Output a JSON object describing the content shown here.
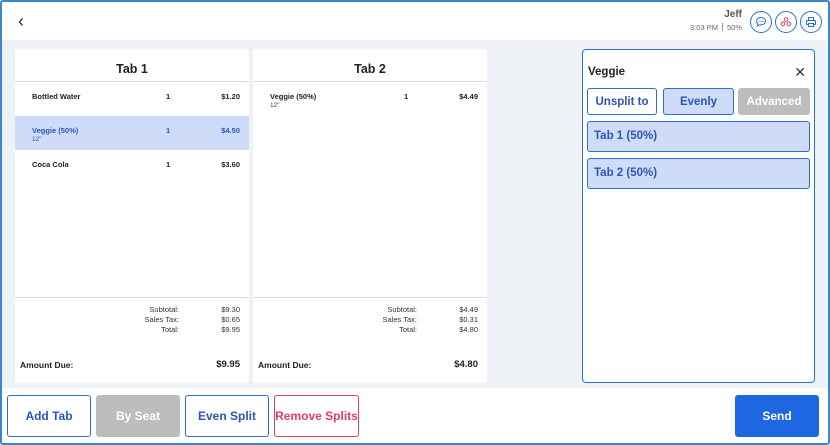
{
  "header": {
    "back_icon": "chevron-left-icon",
    "user_name": "Jeff",
    "time": "3:03 PM",
    "battery": "50%",
    "icons": [
      "chat-icon",
      "group-icon",
      "printer-icon"
    ]
  },
  "tabs": [
    {
      "title": "Tab 1",
      "items": [
        {
          "name": "Bottled Water",
          "sub": "",
          "qty": "1",
          "price": "$1.20",
          "selected": false
        },
        {
          "name": "Veggie (50%)",
          "sub": "12\"",
          "qty": "1",
          "price": "$4.50",
          "selected": true
        },
        {
          "name": "Coca Cola",
          "sub": "",
          "qty": "1",
          "price": "$3.60",
          "selected": false
        }
      ],
      "subtotal_label": "Subtotal:",
      "subtotal": "$9.30",
      "tax_label": "Sales Tax:",
      "tax": "$0.65",
      "total_label": "Total:",
      "total": "$9.95",
      "due_label": "Amount Due:",
      "due": "$9.95"
    },
    {
      "title": "Tab 2",
      "items": [
        {
          "name": "Veggie (50%)",
          "sub": "12\"",
          "qty": "1",
          "price": "$4.49",
          "selected": false
        }
      ],
      "subtotal_label": "Subtotal:",
      "subtotal": "$4.49",
      "tax_label": "Sales Tax:",
      "tax": "$0.31",
      "total_label": "Total:",
      "total": "$4.80",
      "due_label": "Amount Due:",
      "due": "$4.80"
    }
  ],
  "split_panel": {
    "title": "Veggie",
    "close_icon": "close-icon",
    "unsplit_label": "Unsplit to",
    "evenly_label": "Evenly",
    "advanced_label": "Advanced",
    "shares": [
      "Tab 1  (50%)",
      "Tab 2  (50%)"
    ]
  },
  "footer": {
    "add_tab": "Add Tab",
    "by_seat": "By Seat",
    "even_split": "Even Split",
    "remove_splits": "Remove Splits",
    "send": "Send"
  },
  "colors": {
    "accent": "#2a6fd6",
    "selected_bg": "#cfdcf7",
    "danger": "#d9425f",
    "disabled": "#bdbdbd",
    "send_bg": "#1f67e0"
  }
}
